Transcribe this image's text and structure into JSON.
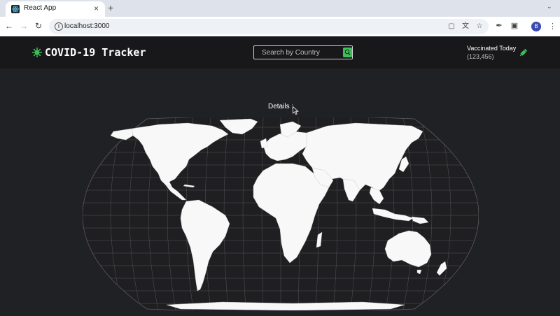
{
  "browser": {
    "tab_title": "React App",
    "tab_close": "×",
    "new_tab": "+",
    "url": "localhost:3000",
    "profile_initial": "B"
  },
  "app": {
    "title": "COVID-19 Tracker",
    "search_placeholder": "Search by Country",
    "vaccinated_label": "Vaccinated Today",
    "vaccinated_count": "(123,456)",
    "details_label": "Details :",
    "accent_color": "#3fbf5a"
  },
  "icons": {
    "logo": "virus-icon",
    "search": "search-icon",
    "vaccine": "syringe-icon",
    "map": "world-map"
  }
}
